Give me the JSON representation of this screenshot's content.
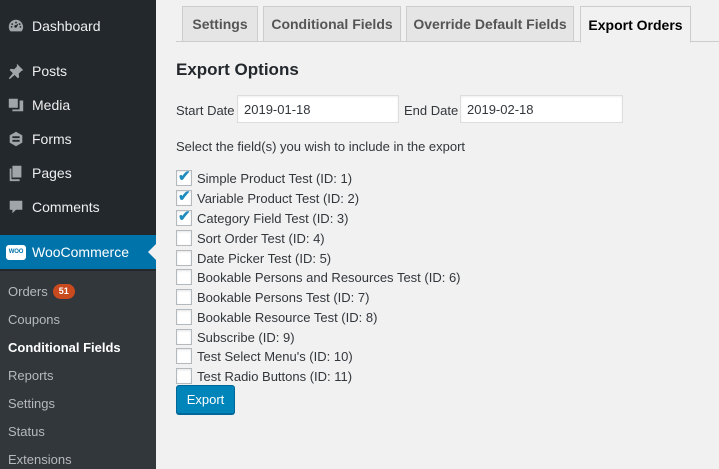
{
  "sidebar": {
    "items": [
      {
        "label": "Dashboard",
        "icon": "dashboard-icon"
      },
      {
        "label": "Posts",
        "icon": "pin-icon"
      },
      {
        "label": "Media",
        "icon": "media-icon"
      },
      {
        "label": "Forms",
        "icon": "forms-icon"
      },
      {
        "label": "Pages",
        "icon": "pages-icon"
      },
      {
        "label": "Comments",
        "icon": "comment-icon"
      },
      {
        "label": "WooCommerce",
        "icon": "woocommerce-icon",
        "active": true
      }
    ],
    "woo_logo_text": "WOO",
    "submenu": [
      {
        "label": "Orders",
        "badge": "51"
      },
      {
        "label": "Coupons"
      },
      {
        "label": "Conditional Fields",
        "current": true
      },
      {
        "label": "Reports"
      },
      {
        "label": "Settings"
      },
      {
        "label": "Status"
      },
      {
        "label": "Extensions"
      }
    ]
  },
  "tabs": [
    {
      "label": "Settings"
    },
    {
      "label": "Conditional Fields"
    },
    {
      "label": "Override Default Fields"
    },
    {
      "label": "Export Orders",
      "active": true
    }
  ],
  "main": {
    "title": "Export Options",
    "start_date_label": "Start Date",
    "start_date_value": "2019-01-18",
    "end_date_label": "End Date",
    "end_date_value": "2019-02-18",
    "instruction": "Select the field(s) you wish to include in the export",
    "fields": [
      {
        "label": "Simple Product Test (ID: 1)",
        "checked": true
      },
      {
        "label": "Variable Product Test (ID: 2)",
        "checked": true
      },
      {
        "label": "Category Field Test (ID: 3)",
        "checked": true
      },
      {
        "label": "Sort Order Test (ID: 4)",
        "checked": false
      },
      {
        "label": "Date Picker Test (ID: 5)",
        "checked": false
      },
      {
        "label": "Bookable Persons and Resources Test (ID: 6)",
        "checked": false
      },
      {
        "label": "Bookable Persons Test (ID: 7)",
        "checked": false
      },
      {
        "label": "Bookable Resource Test (ID: 8)",
        "checked": false
      },
      {
        "label": "Subscribe (ID: 9)",
        "checked": false
      },
      {
        "label": "Test Select Menu's (ID: 10)",
        "checked": false
      },
      {
        "label": "Test Radio Buttons (ID: 11)",
        "checked": false
      }
    ],
    "export_button": "Export"
  },
  "colors": {
    "sidebar_bg": "#23282d",
    "submenu_bg": "#32373c",
    "accent": "#0073aa",
    "badge": "#ca4a1f",
    "button": "#0085ba",
    "checkmark": "#1e8cbe"
  }
}
